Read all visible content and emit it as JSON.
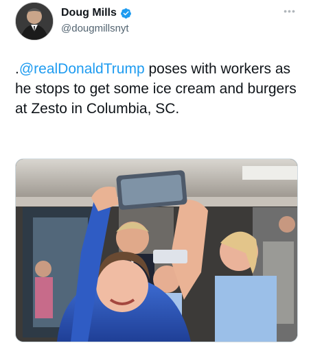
{
  "author": {
    "display_name": "Doug Mills",
    "handle": "@dougmillsnyt",
    "verified": true,
    "avatar_icon": "avatar-photo"
  },
  "tweet": {
    "text_prefix": ".",
    "mention": "@realDonaldTrump",
    "text_body": " poses with workers as he stops to get some ice cream and burgers at Zesto in Columbia, SC."
  },
  "media": {
    "type": "photo",
    "icon": "selfie-photo"
  },
  "colors": {
    "link": "#1d9bf0",
    "verified": "#1d9bf0",
    "handle": "#536471"
  }
}
